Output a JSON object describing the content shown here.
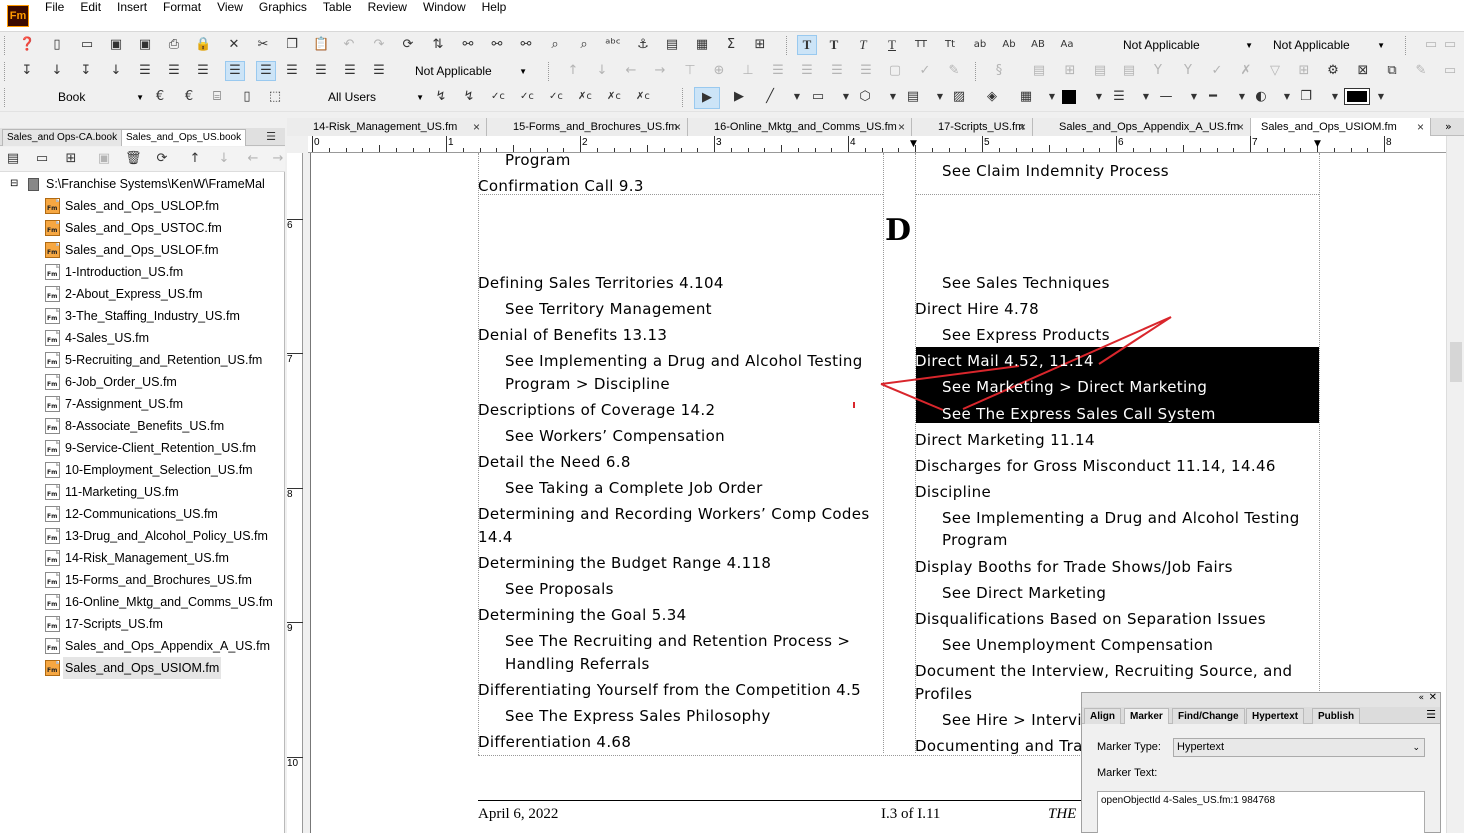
{
  "app": {
    "logo": "Fm"
  },
  "menu": [
    "File",
    "Edit",
    "Insert",
    "Format",
    "View",
    "Graphics",
    "Table",
    "Review",
    "Window",
    "Help"
  ],
  "toolbar": {
    "row1": {
      "para_dropdown": "Not Applicable",
      "char_dropdown": "Not Applicable"
    },
    "row2": {
      "table_dropdown": "Not Applicable"
    },
    "row3": {
      "book_dropdown": "Book",
      "users_dropdown": "All Users"
    }
  },
  "book_tabs": [
    "Sales_and Ops-CA.book",
    "Sales_and_Ops_US.book"
  ],
  "book_tree": {
    "root": "S:\\Franchise Systems\\KenW\\FrameMal",
    "files": [
      {
        "name": "Sales_and_Ops_USLOP.fm",
        "generated": true
      },
      {
        "name": "Sales_and_Ops_USTOC.fm",
        "generated": true
      },
      {
        "name": "Sales_and_Ops_USLOF.fm",
        "generated": true
      },
      {
        "name": "1-Introduction_US.fm",
        "generated": false
      },
      {
        "name": "2-About_Express_US.fm",
        "generated": false
      },
      {
        "name": "3-The_Staffing_Industry_US.fm",
        "generated": false
      },
      {
        "name": "4-Sales_US.fm",
        "generated": false
      },
      {
        "name": "5-Recruiting_and_Retention_US.fm",
        "generated": false
      },
      {
        "name": "6-Job_Order_US.fm",
        "generated": false
      },
      {
        "name": "7-Assignment_US.fm",
        "generated": false
      },
      {
        "name": "8-Associate_Benefits_US.fm",
        "generated": false
      },
      {
        "name": "9-Service-Client_Retention_US.fm",
        "generated": false
      },
      {
        "name": "10-Employment_Selection_US.fm",
        "generated": false
      },
      {
        "name": "11-Marketing_US.fm",
        "generated": false
      },
      {
        "name": "12-Communications_US.fm",
        "generated": false
      },
      {
        "name": "13-Drug_and_Alcohol_Policy_US.fm",
        "generated": false
      },
      {
        "name": "14-Risk_Management_US.fm",
        "generated": false
      },
      {
        "name": "15-Forms_and_Brochures_US.fm",
        "generated": false
      },
      {
        "name": "16-Online_Mktg_and_Comms_US.fm",
        "generated": false
      },
      {
        "name": "17-Scripts_US.fm",
        "generated": false
      },
      {
        "name": "Sales_and_Ops_Appendix_A_US.fm",
        "generated": false
      },
      {
        "name": "Sales_and_Ops_USIOM.fm",
        "generated": true,
        "selected": true
      }
    ]
  },
  "doc_tabs": [
    "14-Risk_Management_US.fm",
    "15-Forms_and_Brochures_US.fm",
    "16-Online_Mktg_and_Comms_US.fm",
    "17-Scripts_US.fm",
    "Sales_and_Ops_Appendix_A_US.fm",
    "Sales_and_Ops_USIOM.fm"
  ],
  "ruler": {
    "h": [
      "0",
      "1",
      "2",
      "3",
      "4",
      "5",
      "6",
      "7",
      "8"
    ],
    "v": [
      "6",
      "7",
      "8",
      "9",
      "10"
    ]
  },
  "doc": {
    "letter": "D",
    "col1": [
      {
        "text": "Program",
        "sub": true
      },
      {
        "text": "Confirmation Call 9.3",
        "sub": false
      },
      {
        "text": "Defining Sales Territories 4.104",
        "sub": false
      },
      {
        "text": "See Territory Management",
        "sub": true
      },
      {
        "text": "Denial of Benefits 13.13",
        "sub": false
      },
      {
        "text": "See Implementing a Drug and Alcohol Testing",
        "sub": true
      },
      {
        "text": "Program > Discipline",
        "sub": true
      },
      {
        "text": "Descriptions of Coverage 14.2",
        "sub": false
      },
      {
        "text": "See Workers’ Compensation",
        "sub": true
      },
      {
        "text": "Detail the Need 6.8",
        "sub": false
      },
      {
        "text": "See Taking a Complete Job Order",
        "sub": true
      },
      {
        "text": "Determining and Recording Workers’ Comp Codes",
        "sub": false
      },
      {
        "text": "14.4",
        "sub": false
      },
      {
        "text": "Determining the Budget Range 4.118",
        "sub": false
      },
      {
        "text": "See Proposals",
        "sub": true
      },
      {
        "text": "Determining the Goal 5.34",
        "sub": false
      },
      {
        "text": "See The Recruiting and Retention Process >",
        "sub": true
      },
      {
        "text": "Handling Referrals",
        "sub": true
      },
      {
        "text": "Differentiating Yourself from the Competition 4.5",
        "sub": false
      },
      {
        "text": "See The Express Sales Philosophy",
        "sub": true
      },
      {
        "text": "Differentiation 4.68",
        "sub": false
      }
    ],
    "col2": [
      {
        "text": "See Claim Indemnity Process",
        "sub": true
      },
      {
        "text": "See Sales Techniques",
        "sub": true
      },
      {
        "text": "Direct Hire 4.78",
        "sub": false
      },
      {
        "text": "See Express Products",
        "sub": true
      },
      {
        "text": "Direct Mail 4.52, 11.14",
        "sub": false,
        "hl": true
      },
      {
        "text": "See Marketing > Direct Marketing",
        "sub": true,
        "hl": true
      },
      {
        "text": "See The Express Sales Call System",
        "sub": true,
        "hl": true
      },
      {
        "text": "Direct Marketing 11.14",
        "sub": false
      },
      {
        "text": "Discharges for Gross Misconduct 11.14, 14.46",
        "sub": false
      },
      {
        "text": "Discipline",
        "sub": false
      },
      {
        "text": "See Implementing a Drug and Alcohol Testing",
        "sub": true
      },
      {
        "text": "Program",
        "sub": true
      },
      {
        "text": "Display Booths for Trade Shows/Job Fairs",
        "sub": false
      },
      {
        "text": "See Direct Marketing",
        "sub": true
      },
      {
        "text": "Disqualifications Based on Separation Issues",
        "sub": false
      },
      {
        "text": "See Unemployment Compensation",
        "sub": true
      },
      {
        "text": "Document the Interview, Recruiting Source, and",
        "sub": false
      },
      {
        "text": "Profiles",
        "sub": false
      },
      {
        "text": "See Hire > Intervie",
        "sub": true
      },
      {
        "text": "Documenting and Trac",
        "sub": false
      }
    ],
    "footer": {
      "date": "April 6, 2022",
      "page": "I.3 of I.11",
      "right": "THE"
    }
  },
  "marker_panel": {
    "tabs": [
      "Align",
      "Marker",
      "Find/Change",
      "Hypertext",
      "Publish"
    ],
    "active_tab": "Marker",
    "type_label": "Marker Type:",
    "type_value": "Hypertext",
    "text_label": "Marker Text:",
    "text_value": "openObjectId 4-Sales_US.fm:1 984768"
  },
  "colors": {
    "highlight": "#000000",
    "annotation": "#d9262c",
    "logo_bg": "#3b0a00",
    "logo_fg": "#ff9a00"
  }
}
